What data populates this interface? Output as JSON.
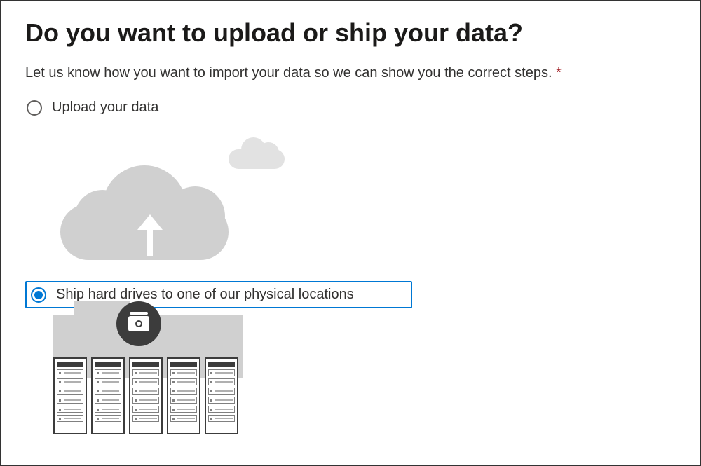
{
  "heading": "Do you want to upload or ship your data?",
  "subtitle": "Let us know how you want to import your data so we can show you the correct steps.",
  "required_marker": "*",
  "options": {
    "upload": {
      "label": "Upload your data",
      "selected": false
    },
    "ship": {
      "label": "Ship hard drives to one of our physical locations",
      "selected": true
    }
  }
}
